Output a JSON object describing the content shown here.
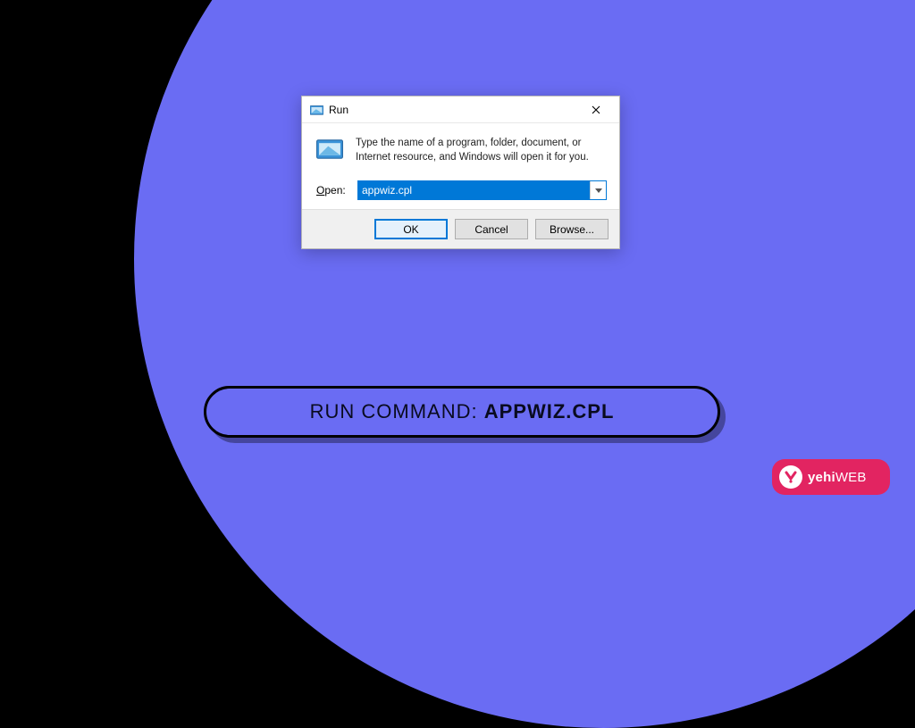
{
  "dialog": {
    "title": "Run",
    "instruction": "Type the name of a program, folder, document, or Internet resource, and Windows will open it for you.",
    "open_label": "Open:",
    "open_value": "appwiz.cpl",
    "buttons": {
      "ok": "OK",
      "cancel": "Cancel",
      "browse": "Browse..."
    }
  },
  "caption": {
    "prefix": "RUN COMMAND: ",
    "command": "APPWIZ.CPL"
  },
  "brand": {
    "name": "yehi",
    "suffix": "WEB",
    "accent": "#e22461"
  },
  "colors": {
    "background_circle": "#6a6cf3",
    "win_accent": "#0078d7"
  }
}
